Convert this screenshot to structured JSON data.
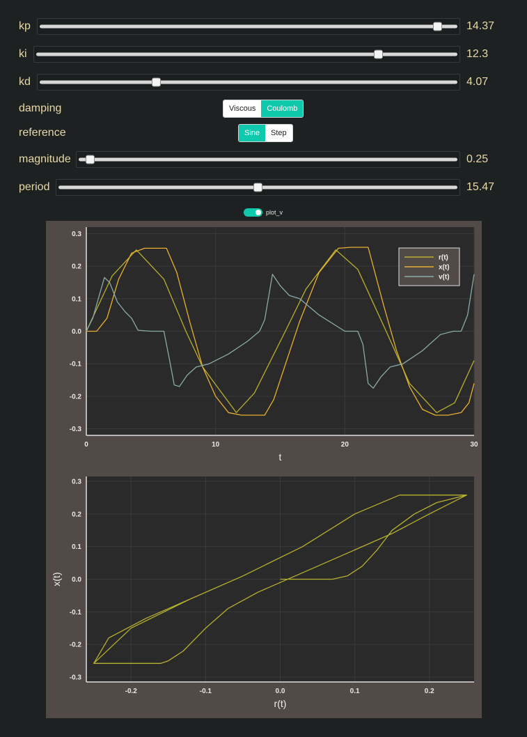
{
  "sliders": [
    {
      "id": "kp",
      "label": "kp",
      "value": "14.37",
      "fraction": 0.955
    },
    {
      "id": "ki",
      "label": "ki",
      "value": "12.3",
      "fraction": 0.815
    },
    {
      "id": "kd",
      "label": "kd",
      "value": "4.07",
      "fraction": 0.28
    },
    {
      "id": "magnitude",
      "label": "magnitude",
      "value": "0.25",
      "fraction": 0.03
    },
    {
      "id": "period",
      "label": "period",
      "value": "15.47",
      "fraction": 0.5
    }
  ],
  "damping": {
    "label": "damping",
    "options": [
      "Viscous",
      "Coulomb"
    ],
    "selected": "Coulomb"
  },
  "reference": {
    "label": "reference",
    "options": [
      "Sine",
      "Step"
    ],
    "selected": "Sine"
  },
  "plot_v_toggle": {
    "label": "plot_v",
    "checked": true
  },
  "colors": {
    "r": "#b8b030",
    "x": "#e8b030",
    "v": "#8aaba8",
    "accent": "#0fc9ac",
    "panel": "#514a47",
    "plot_bg": "#2a2a2a"
  },
  "chart_data": [
    {
      "type": "line",
      "xlabel": "t",
      "ylabel": "",
      "xlim": [
        0,
        30
      ],
      "ylim": [
        -0.32,
        0.32
      ],
      "xticks": [
        0,
        10,
        20,
        30
      ],
      "yticks": [
        -0.3,
        -0.2,
        -0.1,
        0.0,
        0.1,
        0.2,
        0.3
      ],
      "ytick_labels": [
        "-0.3",
        "-0.2",
        "-0.1",
        "0.0",
        "0.1",
        "0.2",
        "0.3"
      ],
      "grid": true,
      "legend": "top-right",
      "series": [
        {
          "name": "r(t)",
          "x": [
            0,
            2,
            3.87,
            6,
            7.7,
            9,
            11.6,
            13,
            15.4,
            17,
            19.3,
            21,
            23.2,
            25,
            27.1,
            28.5,
            30
          ],
          "y": [
            0,
            0.17,
            0.25,
            0.16,
            0,
            -0.11,
            -0.25,
            -0.19,
            0,
            0.13,
            0.25,
            0.19,
            0,
            -0.16,
            -0.25,
            -0.22,
            -0.09
          ]
        },
        {
          "name": "x(t)",
          "x": [
            0,
            0.8,
            1.6,
            2.5,
            3.5,
            4.5,
            6.2,
            7,
            8,
            9,
            10,
            11,
            12,
            13,
            13.8,
            14.5,
            15.5,
            16.5,
            18,
            19.5,
            20.5,
            21.8,
            23,
            24,
            25,
            26,
            27,
            28,
            29,
            29.6,
            30
          ],
          "y": [
            0,
            0,
            0.04,
            0.16,
            0.24,
            0.255,
            0.255,
            0.18,
            0.03,
            -0.11,
            -0.2,
            -0.25,
            -0.258,
            -0.258,
            -0.258,
            -0.21,
            -0.09,
            0.03,
            0.18,
            0.255,
            0.258,
            0.258,
            0.08,
            -0.06,
            -0.17,
            -0.24,
            -0.258,
            -0.258,
            -0.25,
            -0.22,
            -0.16
          ]
        },
        {
          "name": "v(t)",
          "x": [
            0,
            0.5,
            1,
            1.4,
            1.8,
            2.4,
            3,
            3.5,
            4,
            5,
            6,
            6.4,
            6.8,
            7.2,
            7.8,
            8.5,
            9.5,
            11,
            12.5,
            13.4,
            13.8,
            14.4,
            15,
            15.7,
            16.5,
            18,
            20,
            21,
            21.4,
            21.8,
            22.2,
            22.8,
            23.5,
            24.5,
            26,
            27.4,
            28.4,
            29,
            29.5,
            30
          ],
          "y": [
            0,
            0.04,
            0.11,
            0.165,
            0.15,
            0.09,
            0.06,
            0.04,
            0.003,
            0,
            0,
            -0.08,
            -0.165,
            -0.17,
            -0.135,
            -0.11,
            -0.1,
            -0.07,
            -0.03,
            0,
            0.035,
            0.175,
            0.14,
            0.11,
            0.1,
            0.05,
            0,
            0,
            -0.04,
            -0.16,
            -0.175,
            -0.14,
            -0.11,
            -0.1,
            -0.06,
            -0.01,
            0,
            0,
            0.05,
            0.175
          ]
        }
      ]
    },
    {
      "type": "line",
      "xlabel": "r(t)",
      "ylabel": "x(t)",
      "xlim": [
        -0.26,
        0.26
      ],
      "ylim": [
        -0.315,
        0.315
      ],
      "xticks": [
        -0.2,
        -0.1,
        0.0,
        0.1,
        0.2
      ],
      "xtick_labels": [
        "-0.2",
        "-0.1",
        "0.0",
        "0.1",
        "0.2"
      ],
      "yticks": [
        -0.3,
        -0.2,
        -0.1,
        0.0,
        0.1,
        0.2,
        0.3
      ],
      "ytick_labels": [
        "-0.3",
        "-0.2",
        "-0.1",
        "0.0",
        "0.1",
        "0.2",
        "0.3"
      ],
      "grid": true,
      "series": [
        {
          "name": "",
          "x": [
            0,
            0.07,
            0.09,
            0.11,
            0.13,
            0.15,
            0.18,
            0.21,
            0.25,
            0.16,
            0.1,
            0.03,
            -0.05,
            -0.12,
            -0.18,
            -0.23,
            -0.25,
            -0.23,
            -0.16,
            -0.15,
            -0.13,
            -0.1,
            -0.07,
            -0.03,
            0,
            0.05,
            0.1,
            0.15,
            0.2,
            0.25,
            0.16,
            0.1,
            0.03,
            -0.05,
            -0.12,
            -0.2,
            -0.25
          ],
          "y": [
            0,
            0,
            0.01,
            0.04,
            0.09,
            0.15,
            0.2,
            0.235,
            0.258,
            0.258,
            0.2,
            0.1,
            0.01,
            -0.06,
            -0.12,
            -0.18,
            -0.258,
            -0.258,
            -0.258,
            -0.25,
            -0.22,
            -0.15,
            -0.09,
            -0.04,
            -0.01,
            0.04,
            0.09,
            0.14,
            0.2,
            0.258,
            0.258,
            0.2,
            0.1,
            0.01,
            -0.06,
            -0.15,
            -0.258
          ]
        }
      ]
    }
  ]
}
